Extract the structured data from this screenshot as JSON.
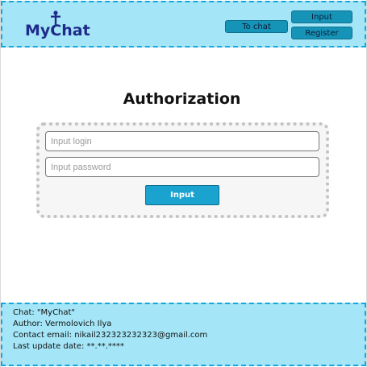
{
  "header": {
    "logo_text": "MyChat",
    "nav": {
      "to_chat": "To chat",
      "input": "Input",
      "register": "Register"
    }
  },
  "main": {
    "title": "Authorization",
    "login_placeholder": "Input login",
    "password_placeholder": "Input password",
    "submit_label": "Input"
  },
  "footer": {
    "chat": "Chat: \"MyChat\"",
    "author": "Author: Vermolovich Ilya",
    "email": "Contact email: nikail232323232323@gmail.com",
    "updated": "Last update date: **.**.****"
  },
  "colors": {
    "header_bg": "#a4e6f7",
    "border_dashed": "#1aa5d8",
    "button": "#1694b8",
    "logo": "#1f2a8a"
  }
}
